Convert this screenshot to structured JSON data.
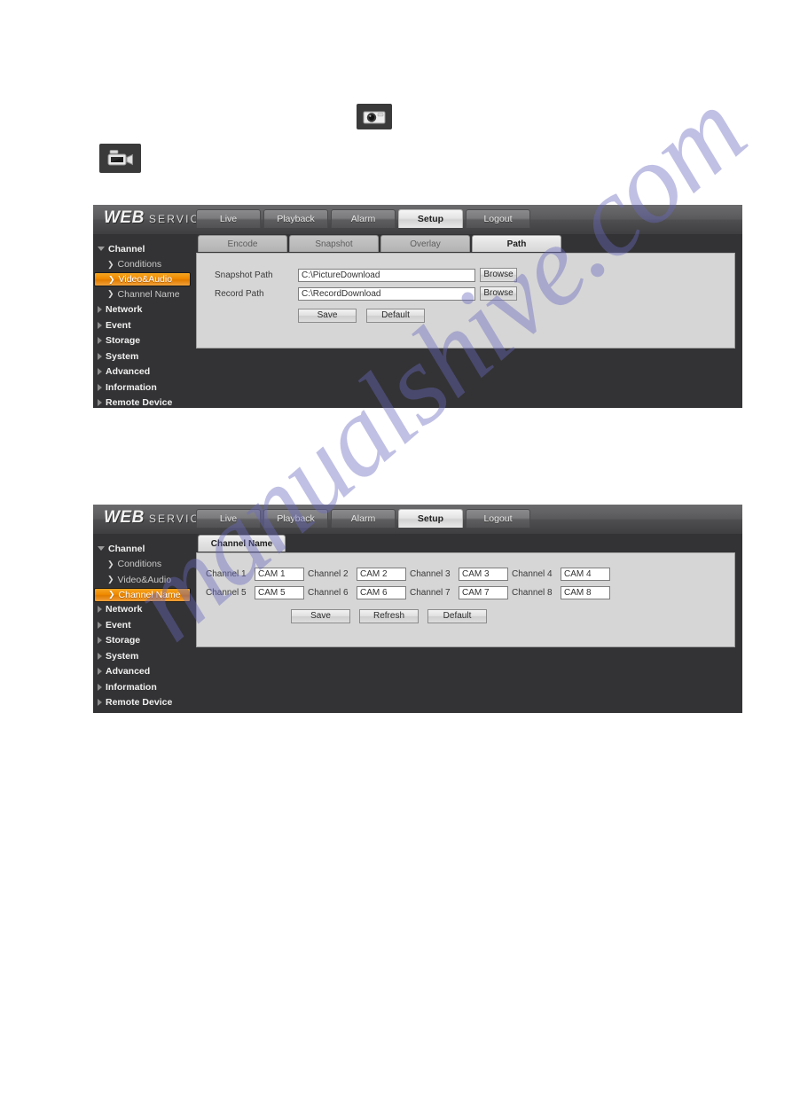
{
  "watermark": {
    "text": "manualshive.com"
  },
  "icons": {
    "snapshot": "camera-photo-icon",
    "record": "video-camera-icon"
  },
  "brand": {
    "web": "WEB",
    "service": "SERVICE"
  },
  "top_nav": {
    "tabs": [
      {
        "label": "Live",
        "active": false
      },
      {
        "label": "Playback",
        "active": false
      },
      {
        "label": "Alarm",
        "active": false
      },
      {
        "label": "Setup",
        "active": true
      },
      {
        "label": "Logout",
        "active": false
      }
    ]
  },
  "sidebar_path": {
    "items": [
      {
        "label": "Channel",
        "type": "group",
        "expanded": true
      },
      {
        "label": "Conditions",
        "type": "child",
        "active": false
      },
      {
        "label": "Video&Audio",
        "type": "child",
        "active": true
      },
      {
        "label": "Channel Name",
        "type": "child",
        "active": false
      },
      {
        "label": "Network",
        "type": "group",
        "expanded": false
      },
      {
        "label": "Event",
        "type": "group",
        "expanded": false
      },
      {
        "label": "Storage",
        "type": "group",
        "expanded": false
      },
      {
        "label": "System",
        "type": "group",
        "expanded": false
      },
      {
        "label": "Advanced",
        "type": "group",
        "expanded": false
      },
      {
        "label": "Information",
        "type": "group",
        "expanded": false
      },
      {
        "label": "Remote Device",
        "type": "group",
        "expanded": false
      }
    ]
  },
  "sidebar_cname": {
    "items": [
      {
        "label": "Channel",
        "type": "group",
        "expanded": true
      },
      {
        "label": "Conditions",
        "type": "child",
        "active": false
      },
      {
        "label": "Video&Audio",
        "type": "child",
        "active": false
      },
      {
        "label": "Channel Name",
        "type": "child",
        "active": true
      },
      {
        "label": "Network",
        "type": "group",
        "expanded": false
      },
      {
        "label": "Event",
        "type": "group",
        "expanded": false
      },
      {
        "label": "Storage",
        "type": "group",
        "expanded": false
      },
      {
        "label": "System",
        "type": "group",
        "expanded": false
      },
      {
        "label": "Advanced",
        "type": "group",
        "expanded": false
      },
      {
        "label": "Information",
        "type": "group",
        "expanded": false
      },
      {
        "label": "Remote Device",
        "type": "group",
        "expanded": false
      }
    ]
  },
  "path_panel": {
    "sub_tabs": [
      {
        "label": "Encode",
        "active": false
      },
      {
        "label": "Snapshot",
        "active": false
      },
      {
        "label": "Overlay",
        "active": false
      },
      {
        "label": "Path",
        "active": true
      }
    ],
    "fields": [
      {
        "label": "Snapshot Path",
        "value": "C:\\PictureDownload",
        "browse": "Browse"
      },
      {
        "label": "Record Path",
        "value": "C:\\RecordDownload",
        "browse": "Browse"
      }
    ],
    "buttons": {
      "save": "Save",
      "default": "Default"
    }
  },
  "cname_panel": {
    "sub_tabs": [
      {
        "label": "Channel Name",
        "active": true
      }
    ],
    "channels": [
      {
        "label": "Channel 1",
        "value": "CAM 1"
      },
      {
        "label": "Channel 2",
        "value": "CAM 2"
      },
      {
        "label": "Channel 3",
        "value": "CAM 3"
      },
      {
        "label": "Channel 4",
        "value": "CAM 4"
      },
      {
        "label": "Channel 5",
        "value": "CAM 5"
      },
      {
        "label": "Channel 6",
        "value": "CAM 6"
      },
      {
        "label": "Channel 7",
        "value": "CAM 7"
      },
      {
        "label": "Channel 8",
        "value": "CAM 8"
      }
    ],
    "buttons": {
      "save": "Save",
      "refresh": "Refresh",
      "default": "Default"
    }
  },
  "colors": {
    "accent_orange": "#f08a00",
    "panel_dark": "#333335",
    "form_gray": "#d6d6d6",
    "watermark": "#6868be"
  }
}
